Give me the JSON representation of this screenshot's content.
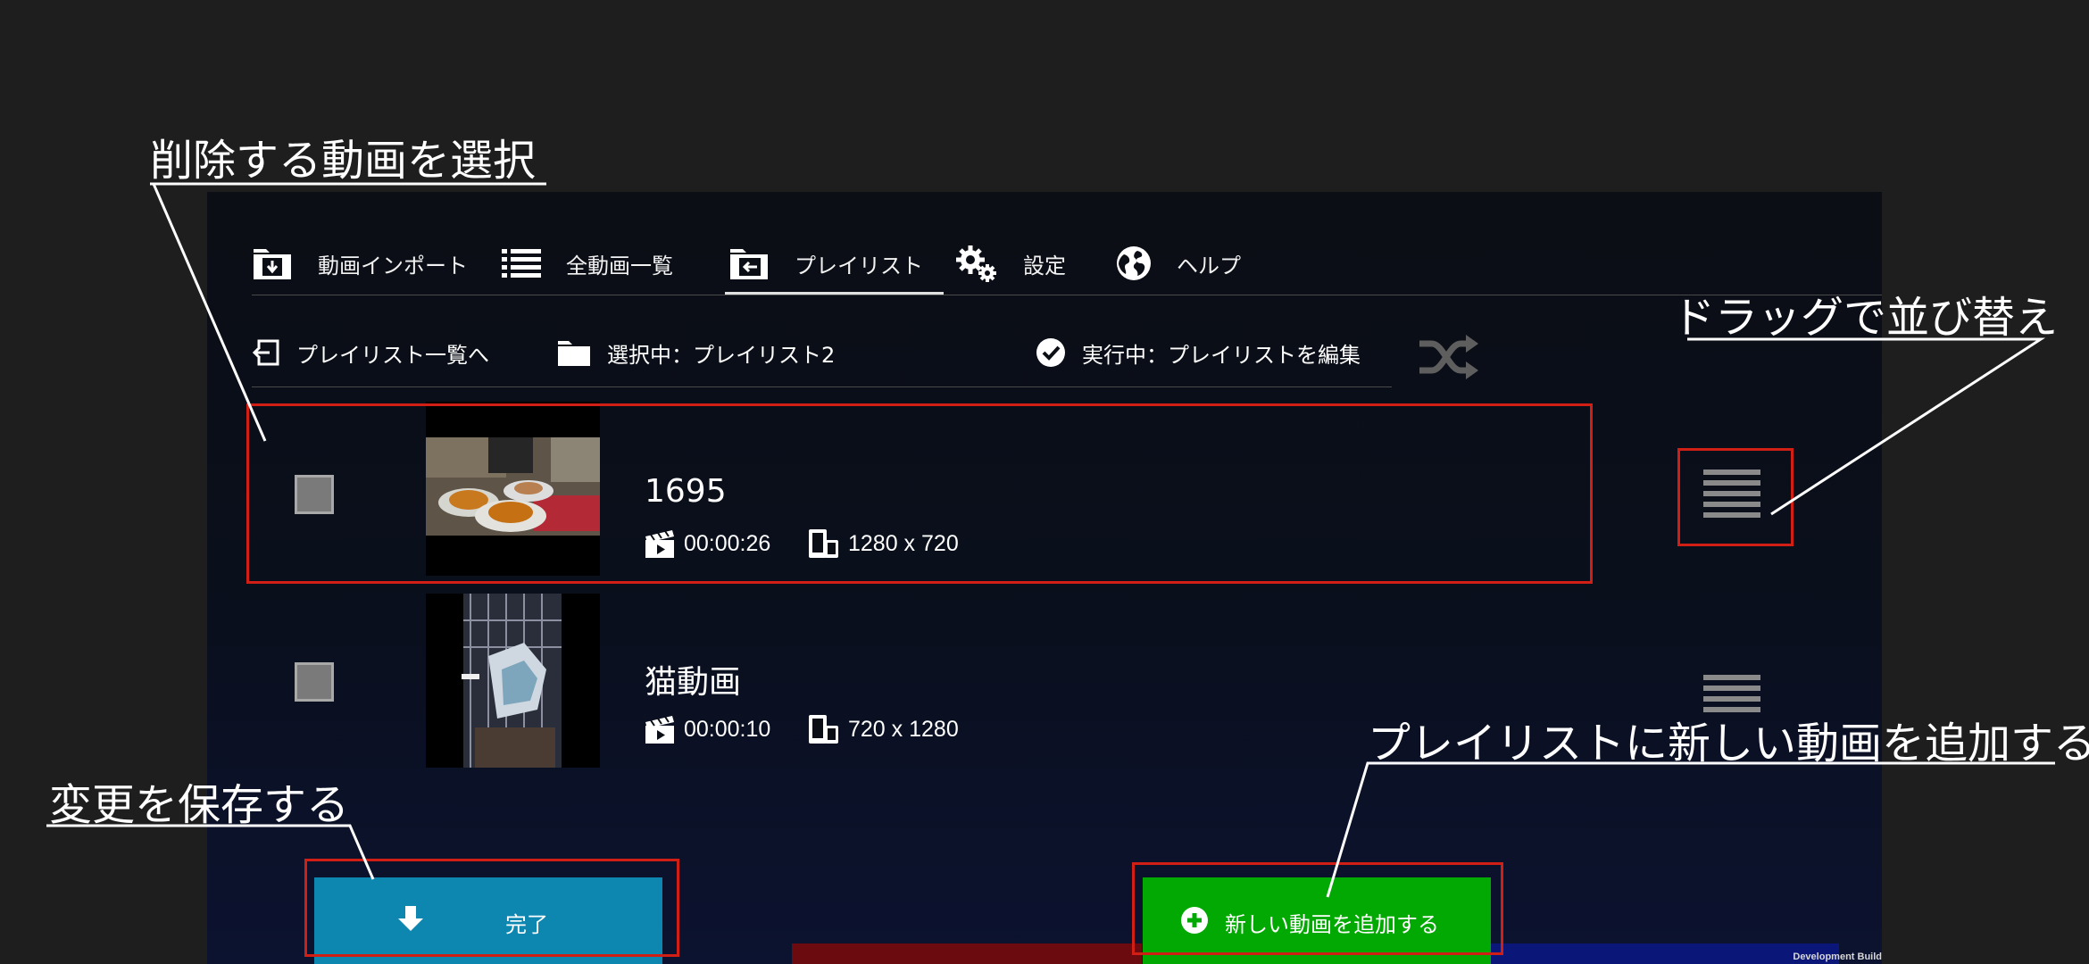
{
  "tabs": [
    {
      "label": "動画インポート",
      "icon": "folder-import-icon"
    },
    {
      "label": "全動画一覧",
      "icon": "list-icon"
    },
    {
      "label": "プレイリスト",
      "icon": "folder-back-icon",
      "active": true
    },
    {
      "label": "設定",
      "icon": "gears-icon"
    },
    {
      "label": "ヘルプ",
      "icon": "globe-icon"
    }
  ],
  "info_bar": {
    "back_label": "プレイリスト一覧へ",
    "selected_label": "選択中：プレイリスト2",
    "mode_label": "実行中：プレイリストを編集",
    "shuffle_icon": "shuffle-icon"
  },
  "videos": [
    {
      "title": "1695",
      "duration": "00:00:26",
      "resolution": "1280 x 720"
    },
    {
      "title": "猫動画",
      "duration": "00:00:10",
      "resolution": "720 x 1280"
    }
  ],
  "buttons": {
    "done_label": "完了",
    "add_label": "新しい動画を追加する"
  },
  "footer": {
    "build_label": "Development Build"
  },
  "annotations": {
    "select_delete": "削除する動画を選択",
    "drag_reorder": "ドラッグで並び替え",
    "add_video": "プレイリストに新しい動画を追加する",
    "save_changes": "変更を保存する"
  },
  "colors": {
    "done_button": "#0d86b0",
    "add_button": "#02a902",
    "highlight": "#d11f16",
    "background": "#1e1e1e"
  }
}
